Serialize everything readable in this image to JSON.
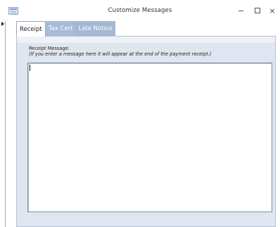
{
  "window": {
    "title": "Customize Messages",
    "icon": "form-icon",
    "controls": {
      "minimize": "–",
      "maximize": "☐",
      "close": "×"
    }
  },
  "tabs": [
    {
      "label": "Receipt",
      "active": true
    },
    {
      "label": "Tax Cert",
      "active": false
    },
    {
      "label": "Late Notice",
      "active": false
    }
  ],
  "receipt_page": {
    "label": "Receipt Message:",
    "hint": "(If you enter a message here it will appear at the end of the payment receipt.)",
    "message_value": ""
  },
  "colors": {
    "tab_inactive": "#a6bbd6",
    "page_background": "#dfe6ef",
    "accent_border": "#7b8ea8"
  }
}
